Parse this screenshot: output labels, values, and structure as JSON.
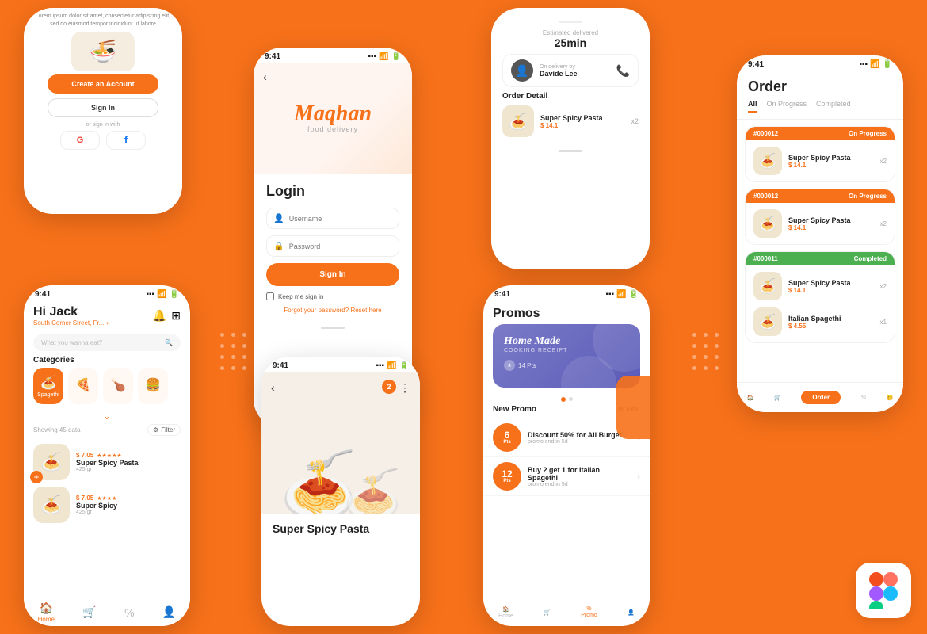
{
  "app": {
    "brand": "Maqhan",
    "brand_sub": "food delivery",
    "accent": "#F7711A"
  },
  "phone_signup": {
    "lorem": "Lorem ipsum dolor sit amet, consectetur adipiscing elit, sed do eiusmod tempor incididunt ut labore",
    "btn_create": "Create an Account",
    "btn_signin": "Sign In",
    "or_text": "or sign in with"
  },
  "phone_login": {
    "title": "Login",
    "username_placeholder": "Username",
    "password_placeholder": "Password",
    "btn_signin": "Sign In",
    "keep_me": "Keep me sign in",
    "forgot": "Forgot your password?",
    "reset": "Reset here"
  },
  "phone_home": {
    "greeting": "Hi Jack",
    "address": "South Corner Street, Fr...",
    "search_placeholder": "What you wanna eat?",
    "categories_title": "Categories",
    "showing": "Showing 45 data",
    "filter": "Filter",
    "categories": [
      {
        "label": "Spagethi",
        "icon": "🍝",
        "active": true
      },
      {
        "label": "Pizza",
        "icon": "🍕",
        "active": false
      },
      {
        "label": "Chicken",
        "icon": "🍗",
        "active": false
      },
      {
        "label": "Burger",
        "icon": "🍔",
        "active": false
      }
    ],
    "foods": [
      {
        "name": "Super Spicy Pasta",
        "price": "$ 7.05",
        "weight": "425 gr",
        "stars": "★★★★★"
      },
      {
        "name": "Super Spicy",
        "price": "$ 7.05",
        "weight": "425 gr",
        "stars": "★★★★"
      }
    ],
    "nav": [
      "Home",
      "Cart",
      "Promo",
      "Profile"
    ]
  },
  "phone_order_detail": {
    "estimated_label": "Estimated delivered",
    "estimated_time": "25min",
    "delivery_by": "On delivery by",
    "driver": "Davide Lee",
    "order_detail_title": "Order Detail",
    "item_name": "Super Spicy Pasta",
    "item_price": "$ 14.1",
    "item_qty": "x2"
  },
  "phone_cart": {
    "food_name": "Super Spicy Pasta",
    "badge_count": "2"
  },
  "phone_promos": {
    "title": "Promos",
    "banner": {
      "title": "Home Made",
      "sub": "COOKING RECEIPT",
      "pts": "14 Pts"
    },
    "new_promo_title": "New Promo",
    "filter": "Filter",
    "items": [
      {
        "pts_num": "6",
        "pts_label": "Pts",
        "name": "Discount 50% for All Burger",
        "end": "promo end in 5d"
      },
      {
        "pts_num": "12",
        "pts_label": "Pts",
        "name": "Buy 2 get 1 for Italian Spagethi",
        "end": "promo end in 5d"
      }
    ],
    "nav": [
      "Home",
      "Cart",
      "Promo",
      "Profile"
    ]
  },
  "phone_orders": {
    "title": "Order",
    "tabs": [
      "All",
      "On Progress",
      "Completed"
    ],
    "active_tab": "All",
    "cards": [
      {
        "order_num": "#000012",
        "status": "On Progress",
        "status_class": "on-progress",
        "name": "Super Spicy Pasta",
        "price": "$ 14.1",
        "qty": "x2"
      },
      {
        "order_num": "#000012",
        "status": "On Progress",
        "status_class": "on-progress",
        "name": "Super Spicy Pasta",
        "price": "$ 14.1",
        "qty": "x2"
      },
      {
        "order_num": "#000011",
        "status": "Completed",
        "status_class": "completed",
        "name": "Super Spicy Pasta",
        "price": "$ 14.1",
        "qty": "x2"
      },
      {
        "order_num": "#000011",
        "status": "Completed",
        "status_class": "completed",
        "name": "Italian Spagethi",
        "price": "$ 4.55",
        "qty": "x1"
      }
    ],
    "nav": [
      "Home",
      "Cart",
      "Order",
      "Profile"
    ]
  }
}
